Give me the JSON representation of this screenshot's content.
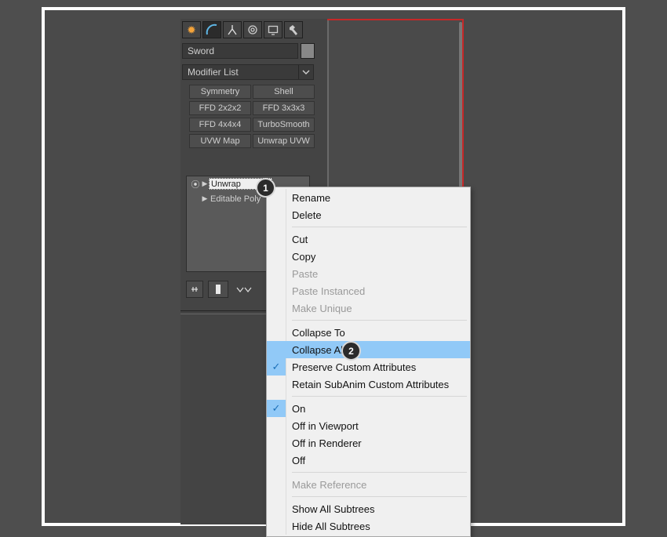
{
  "toolbar": {
    "icons": [
      "sun-icon",
      "arc-icon",
      "tripod-icon",
      "wheel-icon",
      "screen-icon",
      "hammer-icon"
    ],
    "active_index": 1
  },
  "object_name": "Sword",
  "modifier_dropdown": "Modifier List",
  "modifier_buttons": {
    "row1": [
      "Symmetry",
      "Shell"
    ],
    "row2": [
      "FFD 2x2x2",
      "FFD 3x3x3"
    ],
    "row3": [
      "FFD 4x4x4",
      "TurboSmooth"
    ],
    "row4": [
      "UVW Map",
      "Unwrap UVW"
    ]
  },
  "stack": {
    "items": [
      {
        "label": "Unwrap",
        "selected": true,
        "eye": true,
        "tri": true
      },
      {
        "label": "Editable Poly",
        "selected": false,
        "eye": false,
        "tri": true
      }
    ]
  },
  "callouts": {
    "c1": "1",
    "c2": "2"
  },
  "context_menu": {
    "groups": [
      {
        "items": [
          {
            "label": "Rename",
            "enabled": true
          },
          {
            "label": "Delete",
            "enabled": true
          }
        ]
      },
      {
        "items": [
          {
            "label": "Cut",
            "enabled": true
          },
          {
            "label": "Copy",
            "enabled": true
          },
          {
            "label": "Paste",
            "enabled": false
          },
          {
            "label": "Paste Instanced",
            "enabled": false
          },
          {
            "label": "Make Unique",
            "enabled": false
          }
        ]
      },
      {
        "items": [
          {
            "label": "Collapse To",
            "enabled": true
          },
          {
            "label": "Collapse All",
            "enabled": true,
            "highlight": true
          },
          {
            "label": "Preserve Custom Attributes",
            "enabled": true,
            "checked": true
          },
          {
            "label": "Retain SubAnim Custom Attributes",
            "enabled": true
          }
        ]
      },
      {
        "items": [
          {
            "label": "On",
            "enabled": true,
            "checked": true
          },
          {
            "label": "Off in Viewport",
            "enabled": true
          },
          {
            "label": "Off in Renderer",
            "enabled": true
          },
          {
            "label": "Off",
            "enabled": true
          }
        ]
      },
      {
        "items": [
          {
            "label": "Make Reference",
            "enabled": false
          }
        ]
      },
      {
        "items": [
          {
            "label": "Show All Subtrees",
            "enabled": true
          },
          {
            "label": "Hide All Subtrees",
            "enabled": true
          }
        ]
      }
    ]
  }
}
